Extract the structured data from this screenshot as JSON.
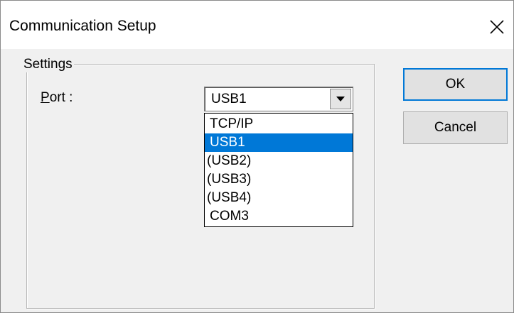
{
  "window": {
    "title": "Communication Setup",
    "close_icon": "close-icon"
  },
  "settings": {
    "group_label": "Settings",
    "port_label_accel": "P",
    "port_label_rest": "ort :",
    "port_selected": "USB1",
    "port_options": [
      "TCP/IP",
      "USB1",
      "(USB2)",
      "(USB3)",
      "(USB4)",
      "COM3"
    ],
    "highlighted_option": "USB1"
  },
  "buttons": {
    "ok": "OK",
    "cancel": "Cancel"
  },
  "colors": {
    "highlight": "#0078d7",
    "dialog_bg": "#f0f0f0"
  }
}
